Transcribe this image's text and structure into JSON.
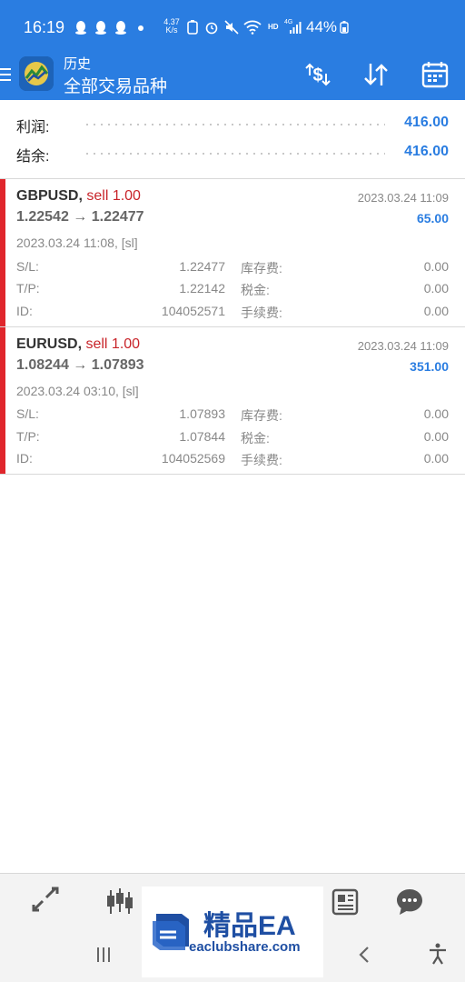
{
  "status_bar": {
    "time": "16:19",
    "speed_value": "4.37",
    "speed_unit": "K/s",
    "network": "HD",
    "signal": "4G",
    "battery": "44%"
  },
  "app_bar": {
    "subtitle": "历史",
    "title": "全部交易品种",
    "icons": [
      "menu-icon",
      "app-logo",
      "currency-sort-icon",
      "sort-arrows-icon",
      "calendar-icon"
    ]
  },
  "summary": {
    "profit_label": "利润:",
    "profit_value": "416.00",
    "balance_label": "结余:",
    "balance_value": "416.00"
  },
  "deals": [
    {
      "symbol": "GBPUSD,",
      "side": "sell 1.00",
      "prices": "1.22542 → 1.22477",
      "close_time": "2023.03.24 11:09",
      "profit": "65.00",
      "open_time": "2023.03.24 11:08, [sl]",
      "sl_label": "S/L:",
      "sl": "1.22477",
      "swap_label": "库存费:",
      "swap": "0.00",
      "tp_label": "T/P:",
      "tp": "1.22142",
      "tax_label": "税金:",
      "tax": "0.00",
      "id_label": "ID:",
      "id": "104052571",
      "fee_label": "手续费:",
      "fee": "0.00"
    },
    {
      "symbol": "EURUSD,",
      "side": "sell 1.00",
      "prices": "1.08244 → 1.07893",
      "close_time": "2023.03.24 11:09",
      "profit": "351.00",
      "open_time": "2023.03.24 03:10, [sl]",
      "sl_label": "S/L:",
      "sl": "1.07893",
      "swap_label": "库存费:",
      "swap": "0.00",
      "tp_label": "T/P:",
      "tp": "1.07844",
      "tax_label": "税金:",
      "tax": "0.00",
      "id_label": "ID:",
      "id": "104052569",
      "fee_label": "手续费:",
      "fee": "0.00"
    }
  ],
  "bottom_nav": [
    "quotes-icon",
    "chart-icon",
    "news-icon",
    "chat-icon"
  ],
  "watermark": {
    "title": "精品EA",
    "subtitle": "eaclubshare.com"
  },
  "colors": {
    "accent": "#2a7de1",
    "sell": "#c8242a",
    "bar": "#e0262c"
  }
}
